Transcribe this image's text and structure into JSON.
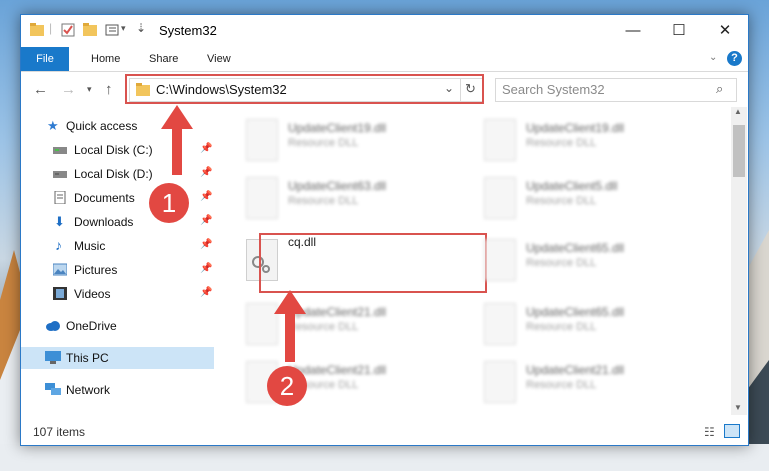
{
  "window": {
    "title": "System32",
    "controls": {
      "minimize": "—",
      "maximize": "☐",
      "close": "✕"
    }
  },
  "ribbon": {
    "tabs": [
      {
        "label": "File"
      },
      {
        "label": "Home"
      },
      {
        "label": "Share"
      },
      {
        "label": "View"
      }
    ],
    "help_icon": "?"
  },
  "navigation": {
    "address": "C:\\Windows\\System32",
    "search_placeholder": "Search System32"
  },
  "sidebar": {
    "items": [
      {
        "label": "Quick access",
        "icon": "star-icon"
      },
      {
        "label": "Local Disk (C:)",
        "icon": "drive-icon"
      },
      {
        "label": "Local Disk (D:)",
        "icon": "drive-icon"
      },
      {
        "label": "Documents",
        "icon": "documents-icon"
      },
      {
        "label": "Downloads",
        "icon": "download-icon"
      },
      {
        "label": "Music",
        "icon": "music-icon"
      },
      {
        "label": "Pictures",
        "icon": "pictures-icon"
      },
      {
        "label": "Videos",
        "icon": "videos-icon"
      },
      {
        "label": "OneDrive",
        "icon": "cloud-icon"
      },
      {
        "label": "This PC",
        "icon": "computer-icon"
      },
      {
        "label": "Network",
        "icon": "network-icon"
      }
    ]
  },
  "files": {
    "left": [
      {
        "name": "UpdateClient19.dll",
        "type": "Resource DLL"
      },
      {
        "name": "UpdateClient63.dll",
        "type": "Resource DLL"
      },
      {
        "name": "cq.dll",
        "type": ""
      },
      {
        "name": "UpdateClient21.dll",
        "type": "Resource DLL"
      },
      {
        "name": "UpdateClient21.dll",
        "type": "Resource DLL"
      }
    ],
    "right": [
      {
        "name": "UpdateClient19.dll",
        "type": "Resource DLL"
      },
      {
        "name": "UpdateClient5.dll",
        "type": "Resource DLL"
      },
      {
        "name": "UpdateClient65.dll",
        "type": "Resource DLL"
      },
      {
        "name": "UpdateClient65.dll",
        "type": "Resource DLL"
      },
      {
        "name": "UpdateClient21.dll",
        "type": "Resource DLL"
      }
    ]
  },
  "status": {
    "item_count": "107 items"
  },
  "annotations": {
    "step1": "1",
    "step2": "2"
  },
  "colors": {
    "accent": "#1979ca",
    "highlight": "#d9534f",
    "selection": "#cce4f7"
  }
}
